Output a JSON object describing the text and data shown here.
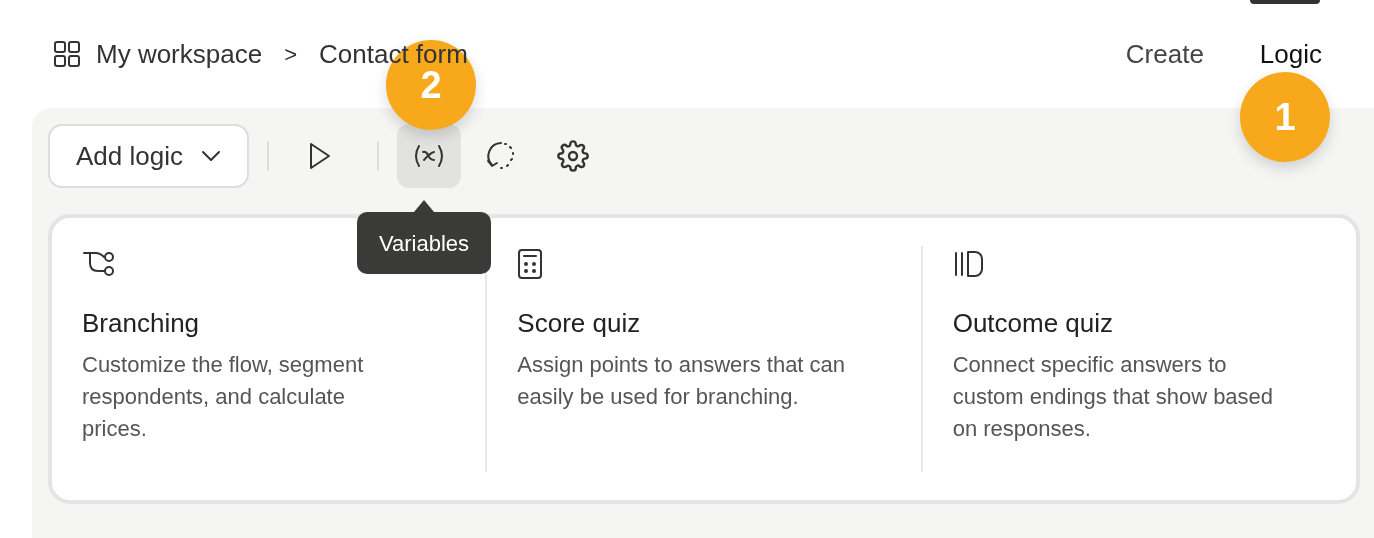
{
  "breadcrumb": {
    "workspace": "My workspace",
    "separator": ">",
    "page": "Contact form"
  },
  "tabs": [
    {
      "label": "Create",
      "selected": false
    },
    {
      "label": "Logic",
      "selected": true
    }
  ],
  "toolbar": {
    "add_logic": "Add logic",
    "tools": [
      {
        "kind": "play",
        "selected": false
      },
      {
        "kind": "variables",
        "selected": true
      },
      {
        "kind": "history",
        "selected": false
      },
      {
        "kind": "settings",
        "selected": false
      }
    ],
    "tooltip": "Variables"
  },
  "options": [
    {
      "kind": "branching",
      "title": "Branching",
      "description": "Customize the flow, segment respondents, and calculate prices."
    },
    {
      "kind": "score",
      "title": "Score quiz",
      "description": "Assign points to answers that can easily be used for branching."
    },
    {
      "kind": "outcome",
      "title": "Outcome quiz",
      "description": "Connect specific answers to custom endings that show based on responses."
    }
  ],
  "callouts": [
    {
      "number": "1"
    },
    {
      "number": "2"
    }
  ]
}
